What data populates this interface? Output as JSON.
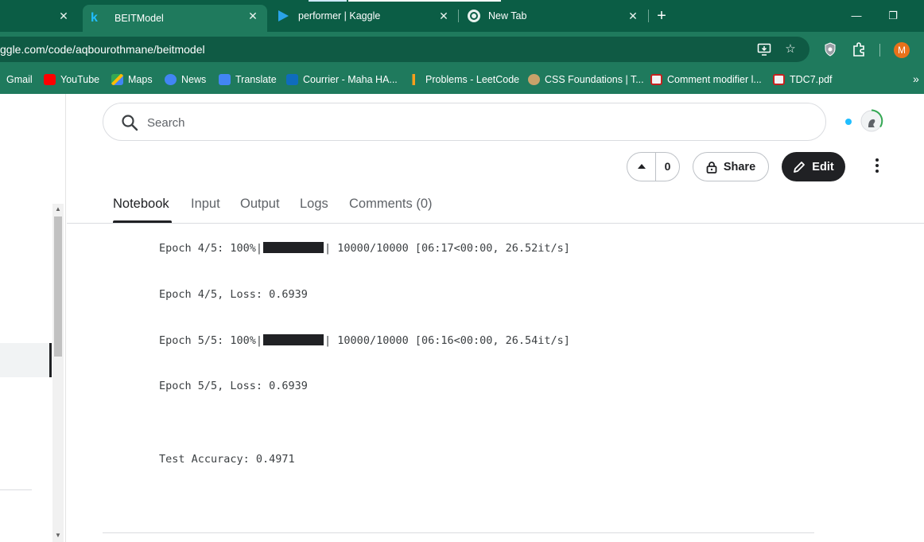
{
  "browser": {
    "tabs": [
      {
        "title": "",
        "favicon": "close-only"
      },
      {
        "title": "BEITModel",
        "favicon": "kaggle-k-icon",
        "active": true
      },
      {
        "title": "performer | Kaggle",
        "favicon": "play-icon"
      },
      {
        "title": "New Tab",
        "favicon": "chrome-icon"
      }
    ],
    "close_glyph": "✕",
    "new_tab_glyph": "+",
    "window_controls": {
      "minimize": "—",
      "restore": "❐",
      "close": "✕"
    },
    "address": "ggle.com/code/aqbourothmane/beitmodel",
    "profile_initial": "M",
    "bookmarks": [
      {
        "label": "Gmail",
        "icon": "gmail-icon"
      },
      {
        "label": "YouTube",
        "icon": "youtube-icon"
      },
      {
        "label": "Maps",
        "icon": "maps-icon"
      },
      {
        "label": "News",
        "icon": "news-icon"
      },
      {
        "label": "Translate",
        "icon": "translate-icon"
      },
      {
        "label": "Courrier - Maha HA...",
        "icon": "outlook-icon"
      },
      {
        "label": "Problems - LeetCode",
        "icon": "leetcode-icon"
      },
      {
        "label": "CSS Foundations | T...",
        "icon": "odin-icon"
      },
      {
        "label": "Comment modifier l...",
        "icon": "doc-icon"
      },
      {
        "label": "TDC7.pdf",
        "icon": "pdf-icon"
      }
    ],
    "more_bookmarks_glyph": "»",
    "colors": {
      "frame": "#0b5d45",
      "toolbar": "#1f7a5d",
      "omnibox": "#0f5a44"
    }
  },
  "page": {
    "search": {
      "placeholder": "Search"
    },
    "vote": {
      "count": "0"
    },
    "share_label": "Share",
    "edit_label": "Edit",
    "tabs": [
      "Notebook",
      "Input",
      "Output",
      "Logs",
      "Comments (0)"
    ],
    "active_tab": "Notebook",
    "output": {
      "epoch4_progress_prefix": "Epoch 4/5: 100%|",
      "epoch4_progress_suffix": "| 10000/10000 [06:17<00:00, 26.52it/s]",
      "epoch4_loss": "Epoch 4/5, Loss: 0.6939",
      "epoch5_progress_prefix": "Epoch 5/5: 100%|",
      "epoch5_progress_suffix": "| 10000/10000 [06:16<00:00, 26.54it/s]",
      "epoch5_loss": "Epoch 5/5, Loss: 0.6939",
      "test_accuracy": "Test Accuracy: 0.4971"
    },
    "progress_fraction": 1.0
  }
}
